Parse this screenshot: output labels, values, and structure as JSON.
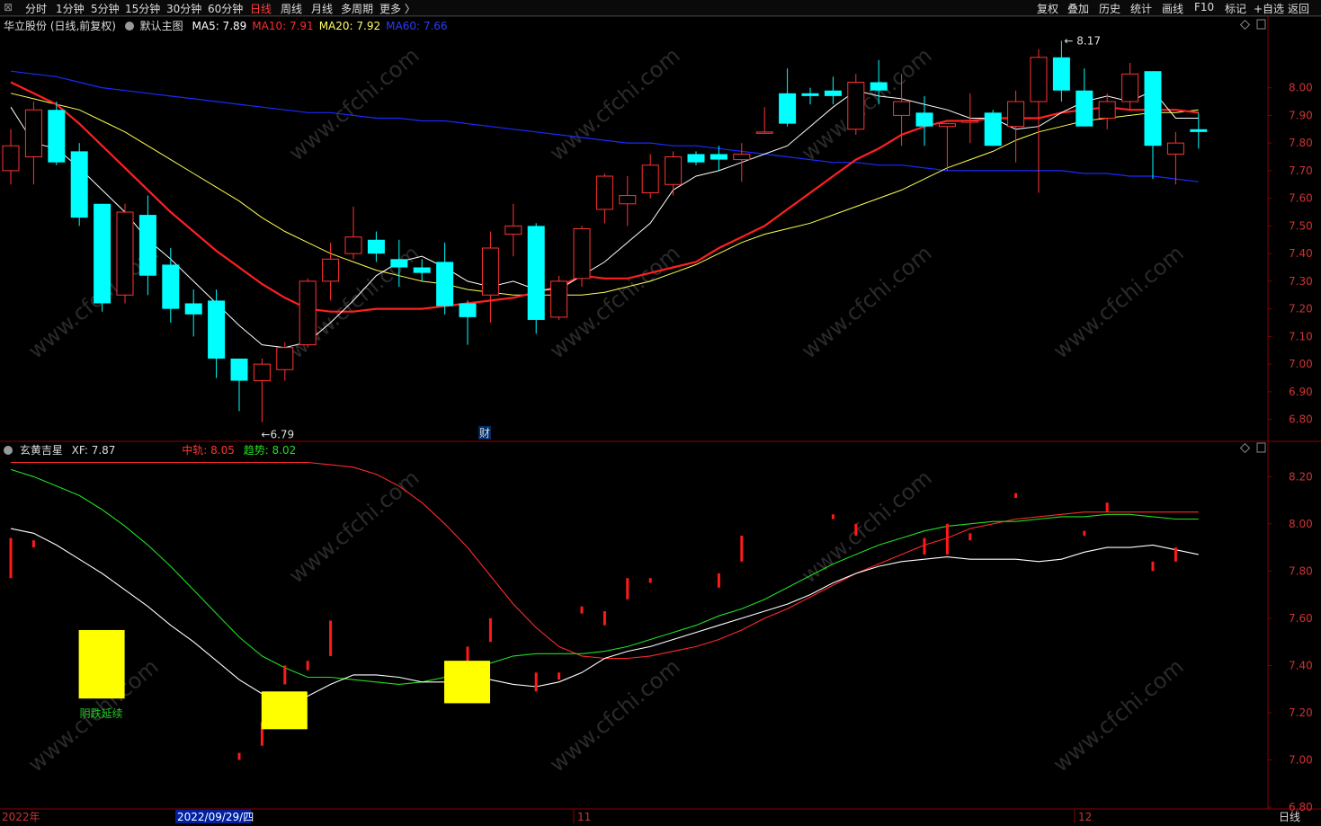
{
  "toolbar": {
    "icon_label": "⊠",
    "left_items": [
      "分时",
      "1分钟",
      "5分钟",
      "15分钟",
      "30分钟",
      "60分钟",
      "日线",
      "周线",
      "月线",
      "多周期",
      "更多 〉"
    ],
    "active_item": "日线",
    "right_items": [
      "复权",
      "叠加",
      "历史",
      "统计",
      "画线",
      "F10",
      "标记",
      "+自选",
      "返回"
    ]
  },
  "main_chart": {
    "stock": "华立股份 (日线,前复权)",
    "template": "默认主图",
    "ma": [
      {
        "label": "MA5: 7.89",
        "color": "#ffffff"
      },
      {
        "label": "MA10: 7.91",
        "color": "#ff2a2a"
      },
      {
        "label": "MA20: 7.92",
        "color": "#ffff66"
      },
      {
        "label": "MA60: 7.66",
        "color": "#2a3cff"
      }
    ],
    "high_label": "8.17",
    "low_label": "6.79",
    "event_marker": "财",
    "y_ticks": [
      "8.00",
      "7.90",
      "7.80",
      "7.70",
      "7.60",
      "7.50",
      "7.40",
      "7.30",
      "7.20",
      "7.10",
      "7.00",
      "6.90",
      "6.80"
    ]
  },
  "sub_chart": {
    "name": "玄黄吉星",
    "xf_label": "XF: 7.87",
    "mid_label": "中轨: 8.05",
    "trend_label": "趋势: 8.02",
    "signal_text": "阴跌延续",
    "y_ticks": [
      "8.20",
      "8.00",
      "7.80",
      "7.60",
      "7.40",
      "7.20",
      "7.00",
      "6.80"
    ]
  },
  "xaxis": {
    "year_label": "2022年",
    "cursor_date": "2022/09/29/四",
    "month_labels": [
      "11",
      "12"
    ],
    "period_label": "日线"
  },
  "watermark": "www.cfchi.com",
  "colors": {
    "up": "#ff3333",
    "down": "#00ffff",
    "ma5": "#ffffff",
    "ma10": "#ff2020",
    "ma20": "#ffff55",
    "ma60": "#1a2aff",
    "grid": "#8b0000"
  },
  "chart_data": [
    {
      "type": "candlestick",
      "title": "华立股份 (日线,前复权)",
      "ylim": [
        6.75,
        8.22
      ],
      "candles": [
        {
          "o": 7.7,
          "h": 7.85,
          "l": 7.65,
          "c": 7.79
        },
        {
          "o": 7.75,
          "h": 7.95,
          "l": 7.65,
          "c": 7.92
        },
        {
          "o": 7.92,
          "h": 7.95,
          "l": 7.72,
          "c": 7.73
        },
        {
          "o": 7.77,
          "h": 7.8,
          "l": 7.5,
          "c": 7.53
        },
        {
          "o": 7.58,
          "h": 7.58,
          "l": 7.19,
          "c": 7.22
        },
        {
          "o": 7.25,
          "h": 7.58,
          "l": 7.22,
          "c": 7.55
        },
        {
          "o": 7.54,
          "h": 7.61,
          "l": 7.25,
          "c": 7.32
        },
        {
          "o": 7.36,
          "h": 7.42,
          "l": 7.15,
          "c": 7.2
        },
        {
          "o": 7.22,
          "h": 7.27,
          "l": 7.1,
          "c": 7.18
        },
        {
          "o": 7.23,
          "h": 7.27,
          "l": 6.95,
          "c": 7.02
        },
        {
          "o": 7.02,
          "h": 7.02,
          "l": 6.83,
          "c": 6.94
        },
        {
          "o": 6.94,
          "h": 7.02,
          "l": 6.79,
          "c": 7.0
        },
        {
          "o": 6.98,
          "h": 7.08,
          "l": 6.94,
          "c": 7.06
        },
        {
          "o": 7.07,
          "h": 7.31,
          "l": 7.06,
          "c": 7.3
        },
        {
          "o": 7.3,
          "h": 7.44,
          "l": 7.23,
          "c": 7.38
        },
        {
          "o": 7.4,
          "h": 7.57,
          "l": 7.38,
          "c": 7.46
        },
        {
          "o": 7.45,
          "h": 7.48,
          "l": 7.37,
          "c": 7.4
        },
        {
          "o": 7.38,
          "h": 7.45,
          "l": 7.28,
          "c": 7.35
        },
        {
          "o": 7.35,
          "h": 7.38,
          "l": 7.3,
          "c": 7.33
        },
        {
          "o": 7.37,
          "h": 7.44,
          "l": 7.18,
          "c": 7.21
        },
        {
          "o": 7.22,
          "h": 7.23,
          "l": 7.07,
          "c": 7.17
        },
        {
          "o": 7.25,
          "h": 7.48,
          "l": 7.15,
          "c": 7.42
        },
        {
          "o": 7.47,
          "h": 7.58,
          "l": 7.39,
          "c": 7.5
        },
        {
          "o": 7.5,
          "h": 7.51,
          "l": 7.11,
          "c": 7.16
        },
        {
          "o": 7.17,
          "h": 7.32,
          "l": 7.16,
          "c": 7.3
        },
        {
          "o": 7.31,
          "h": 7.5,
          "l": 7.28,
          "c": 7.49
        },
        {
          "o": 7.56,
          "h": 7.69,
          "l": 7.51,
          "c": 7.68
        },
        {
          "o": 7.58,
          "h": 7.68,
          "l": 7.5,
          "c": 7.61
        },
        {
          "o": 7.62,
          "h": 7.76,
          "l": 7.6,
          "c": 7.72
        },
        {
          "o": 7.65,
          "h": 7.77,
          "l": 7.61,
          "c": 7.75
        },
        {
          "o": 7.76,
          "h": 7.77,
          "l": 7.72,
          "c": 7.73
        },
        {
          "o": 7.76,
          "h": 7.79,
          "l": 7.7,
          "c": 7.74
        },
        {
          "o": 7.74,
          "h": 7.8,
          "l": 7.66,
          "c": 7.76
        },
        {
          "o": 7.84,
          "h": 7.93,
          "l": 7.84,
          "c": 7.84
        },
        {
          "o": 7.98,
          "h": 8.07,
          "l": 7.86,
          "c": 7.87
        },
        {
          "o": 7.98,
          "h": 8.0,
          "l": 7.94,
          "c": 7.97
        },
        {
          "o": 7.99,
          "h": 8.04,
          "l": 7.94,
          "c": 7.97
        },
        {
          "o": 7.85,
          "h": 8.05,
          "l": 7.83,
          "c": 8.02
        },
        {
          "o": 8.02,
          "h": 8.1,
          "l": 7.94,
          "c": 7.99
        },
        {
          "o": 7.9,
          "h": 8.05,
          "l": 7.79,
          "c": 7.95
        },
        {
          "o": 7.91,
          "h": 7.97,
          "l": 7.79,
          "c": 7.86
        },
        {
          "o": 7.86,
          "h": 7.86,
          "l": 7.7,
          "c": 7.87
        },
        {
          "o": 7.88,
          "h": 7.98,
          "l": 7.8,
          "c": 7.88
        },
        {
          "o": 7.91,
          "h": 7.92,
          "l": 7.79,
          "c": 7.79
        },
        {
          "o": 7.86,
          "h": 7.99,
          "l": 7.73,
          "c": 7.95
        },
        {
          "o": 7.95,
          "h": 8.14,
          "l": 7.62,
          "c": 8.11
        },
        {
          "o": 8.11,
          "h": 8.17,
          "l": 7.95,
          "c": 7.99
        },
        {
          "o": 7.99,
          "h": 8.07,
          "l": 7.86,
          "c": 7.86
        },
        {
          "o": 7.89,
          "h": 7.98,
          "l": 7.85,
          "c": 7.95
        },
        {
          "o": 7.95,
          "h": 8.09,
          "l": 7.92,
          "c": 8.05
        },
        {
          "o": 8.06,
          "h": 8.06,
          "l": 7.67,
          "c": 7.79
        },
        {
          "o": 7.76,
          "h": 7.84,
          "l": 7.65,
          "c": 7.8
        },
        {
          "o": 7.85,
          "h": 7.91,
          "l": 7.78,
          "c": 7.84
        }
      ],
      "ma5": [
        7.93,
        7.8,
        7.78,
        7.71,
        7.63,
        7.55,
        7.45,
        7.38,
        7.3,
        7.22,
        7.14,
        7.07,
        7.06,
        7.08,
        7.15,
        7.23,
        7.32,
        7.37,
        7.39,
        7.35,
        7.3,
        7.28,
        7.3,
        7.27,
        7.27,
        7.32,
        7.37,
        7.44,
        7.51,
        7.63,
        7.68,
        7.7,
        7.73,
        7.76,
        7.79,
        7.86,
        7.93,
        7.99,
        7.97,
        7.96,
        7.94,
        7.92,
        7.89,
        7.89,
        7.85,
        7.86,
        7.91,
        7.95,
        7.97,
        7.95,
        7.99,
        7.89,
        7.89
      ],
      "ma10": [
        8.02,
        7.98,
        7.94,
        7.87,
        7.79,
        7.71,
        7.63,
        7.55,
        7.48,
        7.41,
        7.35,
        7.29,
        7.24,
        7.2,
        7.19,
        7.19,
        7.2,
        7.2,
        7.2,
        7.21,
        7.22,
        7.23,
        7.24,
        7.26,
        7.28,
        7.32,
        7.31,
        7.31,
        7.33,
        7.35,
        7.37,
        7.42,
        7.46,
        7.5,
        7.56,
        7.62,
        7.68,
        7.74,
        7.78,
        7.83,
        7.86,
        7.88,
        7.88,
        7.89,
        7.89,
        7.89,
        7.91,
        7.92,
        7.93,
        7.92,
        7.92,
        7.92,
        7.91
      ],
      "ma20": [
        7.98,
        7.96,
        7.94,
        7.92,
        7.88,
        7.84,
        7.79,
        7.74,
        7.69,
        7.64,
        7.59,
        7.53,
        7.48,
        7.44,
        7.4,
        7.37,
        7.34,
        7.32,
        7.3,
        7.29,
        7.27,
        7.26,
        7.25,
        7.25,
        7.25,
        7.25,
        7.26,
        7.28,
        7.3,
        7.33,
        7.36,
        7.4,
        7.44,
        7.47,
        7.49,
        7.51,
        7.54,
        7.57,
        7.6,
        7.63,
        7.67,
        7.71,
        7.74,
        7.77,
        7.81,
        7.84,
        7.86,
        7.88,
        7.89,
        7.9,
        7.91,
        7.91,
        7.92
      ],
      "ma60": [
        8.06,
        8.05,
        8.04,
        8.02,
        8.0,
        7.99,
        7.98,
        7.97,
        7.96,
        7.95,
        7.94,
        7.93,
        7.92,
        7.91,
        7.91,
        7.9,
        7.89,
        7.89,
        7.88,
        7.88,
        7.87,
        7.86,
        7.85,
        7.84,
        7.83,
        7.82,
        7.81,
        7.8,
        7.8,
        7.79,
        7.79,
        7.78,
        7.77,
        7.76,
        7.75,
        7.74,
        7.73,
        7.73,
        7.72,
        7.72,
        7.71,
        7.7,
        7.7,
        7.7,
        7.7,
        7.7,
        7.7,
        7.69,
        7.69,
        7.68,
        7.68,
        7.67,
        7.66
      ]
    },
    {
      "type": "line",
      "title": "玄黄吉星",
      "ylim": [
        6.8,
        8.3
      ],
      "series": [
        {
          "name": "中轨",
          "color": "#ff2a2a",
          "values": [
            8.26,
            8.26,
            8.26,
            8.26,
            8.26,
            8.26,
            8.26,
            8.26,
            8.26,
            8.26,
            8.26,
            8.26,
            8.26,
            8.26,
            8.25,
            8.24,
            8.21,
            8.16,
            8.09,
            8.0,
            7.9,
            7.78,
            7.66,
            7.56,
            7.48,
            7.44,
            7.43,
            7.43,
            7.44,
            7.46,
            7.48,
            7.51,
            7.55,
            7.6,
            7.64,
            7.69,
            7.74,
            7.79,
            7.83,
            7.87,
            7.91,
            7.94,
            7.98,
            8.0,
            8.02,
            8.03,
            8.04,
            8.05,
            8.05,
            8.05,
            8.05,
            8.05,
            8.05
          ]
        },
        {
          "name": "趋势",
          "color": "#22dd22",
          "values": [
            8.23,
            8.2,
            8.16,
            8.12,
            8.06,
            7.99,
            7.91,
            7.82,
            7.72,
            7.62,
            7.52,
            7.44,
            7.39,
            7.35,
            7.35,
            7.34,
            7.33,
            7.32,
            7.33,
            7.35,
            7.38,
            7.41,
            7.44,
            7.45,
            7.45,
            7.45,
            7.46,
            7.48,
            7.51,
            7.54,
            7.57,
            7.61,
            7.64,
            7.68,
            7.73,
            7.78,
            7.83,
            7.87,
            7.91,
            7.94,
            7.97,
            7.99,
            8.0,
            8.01,
            8.01,
            8.02,
            8.03,
            8.03,
            8.04,
            8.04,
            8.03,
            8.02,
            8.02
          ]
        },
        {
          "name": "XF",
          "color": "#ffffff",
          "values": [
            7.98,
            7.96,
            7.91,
            7.85,
            7.79,
            7.72,
            7.65,
            7.57,
            7.5,
            7.42,
            7.34,
            7.28,
            7.25,
            7.27,
            7.32,
            7.36,
            7.36,
            7.35,
            7.33,
            7.33,
            7.35,
            7.34,
            7.32,
            7.31,
            7.33,
            7.37,
            7.43,
            7.46,
            7.48,
            7.51,
            7.54,
            7.57,
            7.6,
            7.63,
            7.66,
            7.7,
            7.75,
            7.79,
            7.82,
            7.84,
            7.85,
            7.86,
            7.85,
            7.85,
            7.85,
            7.84,
            7.85,
            7.88,
            7.9,
            7.9,
            7.91,
            7.89,
            7.87
          ]
        }
      ],
      "bars": [
        {
          "i": 0,
          "lo": 7.77,
          "hi": 7.94
        },
        {
          "i": 1,
          "lo": 7.9,
          "hi": 7.93
        },
        {
          "i": 10,
          "lo": 7.0,
          "hi": 7.03
        },
        {
          "i": 11,
          "lo": 7.06,
          "hi": 7.16
        },
        {
          "i": 12,
          "lo": 7.32,
          "hi": 7.4
        },
        {
          "i": 13,
          "lo": 7.38,
          "hi": 7.42
        },
        {
          "i": 14,
          "lo": 7.44,
          "hi": 7.59
        },
        {
          "i": 20,
          "lo": 7.4,
          "hi": 7.48
        },
        {
          "i": 21,
          "lo": 7.5,
          "hi": 7.6
        },
        {
          "i": 23,
          "lo": 7.29,
          "hi": 7.37
        },
        {
          "i": 24,
          "lo": 7.34,
          "hi": 7.37
        },
        {
          "i": 25,
          "lo": 7.62,
          "hi": 7.65
        },
        {
          "i": 26,
          "lo": 7.57,
          "hi": 7.63
        },
        {
          "i": 27,
          "lo": 7.68,
          "hi": 7.77
        },
        {
          "i": 28,
          "lo": 7.75,
          "hi": 7.77
        },
        {
          "i": 31,
          "lo": 7.73,
          "hi": 7.79
        },
        {
          "i": 32,
          "lo": 7.84,
          "hi": 7.95
        },
        {
          "i": 36,
          "lo": 8.02,
          "hi": 8.04
        },
        {
          "i": 37,
          "lo": 7.95,
          "hi": 8.0
        },
        {
          "i": 40,
          "lo": 7.87,
          "hi": 7.94
        },
        {
          "i": 41,
          "lo": 7.87,
          "hi": 8.0
        },
        {
          "i": 42,
          "lo": 7.93,
          "hi": 7.96
        },
        {
          "i": 44,
          "lo": 8.11,
          "hi": 8.13
        },
        {
          "i": 47,
          "lo": 7.95,
          "hi": 7.97
        },
        {
          "i": 48,
          "lo": 8.05,
          "hi": 8.09
        },
        {
          "i": 50,
          "lo": 7.8,
          "hi": 7.84
        },
        {
          "i": 51,
          "lo": 7.84,
          "hi": 7.9
        }
      ],
      "signals": [
        {
          "i": 4,
          "lo": 7.26,
          "hi": 7.55
        },
        {
          "i": 12,
          "lo": 7.13,
          "hi": 7.29
        },
        {
          "i": 20,
          "lo": 7.24,
          "hi": 7.42
        }
      ]
    }
  ]
}
